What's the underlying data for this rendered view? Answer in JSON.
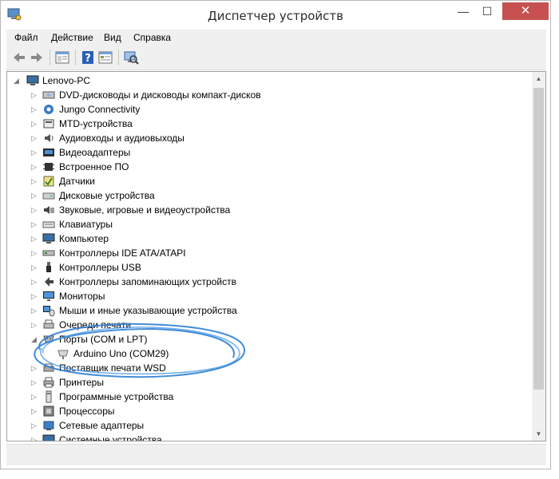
{
  "window": {
    "title": "Диспетчер устройств",
    "minimize_glyph": "—",
    "maximize_glyph": "☐",
    "close_glyph": "✕"
  },
  "menu": {
    "items": [
      "Файл",
      "Действие",
      "Вид",
      "Справка"
    ]
  },
  "toolbar": {
    "buttons": [
      "back-arrow-icon",
      "forward-arrow-icon",
      "properties-icon",
      "help-icon",
      "view-icon",
      "scan-hardware-icon"
    ]
  },
  "tree": {
    "root": "Lenovo-PC",
    "items": [
      {
        "label": "DVD-дисководы и дисководы компакт-дисков",
        "icon": "dvd-drive-icon"
      },
      {
        "label": "Jungo Connectivity",
        "icon": "jungo-icon"
      },
      {
        "label": "MTD-устройства",
        "icon": "mtd-device-icon"
      },
      {
        "label": "Аудиовходы и аудиовыходы",
        "icon": "speaker-icon"
      },
      {
        "label": "Видеоадаптеры",
        "icon": "display-adapter-icon"
      },
      {
        "label": "Встроенное ПО",
        "icon": "firmware-icon"
      },
      {
        "label": "Датчики",
        "icon": "sensor-icon"
      },
      {
        "label": "Дисковые устройства",
        "icon": "disk-drive-icon"
      },
      {
        "label": "Звуковые, игровые и видеоустройства",
        "icon": "sound-device-icon"
      },
      {
        "label": "Клавиатуры",
        "icon": "keyboard-icon"
      },
      {
        "label": "Компьютер",
        "icon": "computer-icon"
      },
      {
        "label": "Контроллеры IDE ATA/ATAPI",
        "icon": "ide-controller-icon"
      },
      {
        "label": "Контроллеры USB",
        "icon": "usb-icon"
      },
      {
        "label": "Контроллеры запоминающих устройств",
        "icon": "storage-controller-icon"
      },
      {
        "label": "Мониторы",
        "icon": "monitor-icon"
      },
      {
        "label": "Мыши и иные указывающие устройства",
        "icon": "mouse-icon"
      },
      {
        "label": "Очереди печати",
        "icon": "print-queue-icon"
      },
      {
        "label": "Порты (COM и LPT)",
        "icon": "port-icon",
        "expanded": true
      },
      {
        "label": "Arduino Uno (COM29)",
        "icon": "port-device-icon",
        "child": true
      },
      {
        "label": "Поставщик печати WSD",
        "icon": "wsd-printer-icon"
      },
      {
        "label": "Принтеры",
        "icon": "printer-icon"
      },
      {
        "label": "Программные устройства",
        "icon": "software-device-icon"
      },
      {
        "label": "Процессоры",
        "icon": "processor-icon"
      },
      {
        "label": "Сетевые адаптеры",
        "icon": "network-adapter-icon"
      },
      {
        "label": "Системные устройства",
        "icon": "system-device-icon"
      }
    ]
  },
  "colors": {
    "accent_circle": "#2f7fd3",
    "close_button": "#c75050",
    "root_icon": "#3a6ea5"
  }
}
